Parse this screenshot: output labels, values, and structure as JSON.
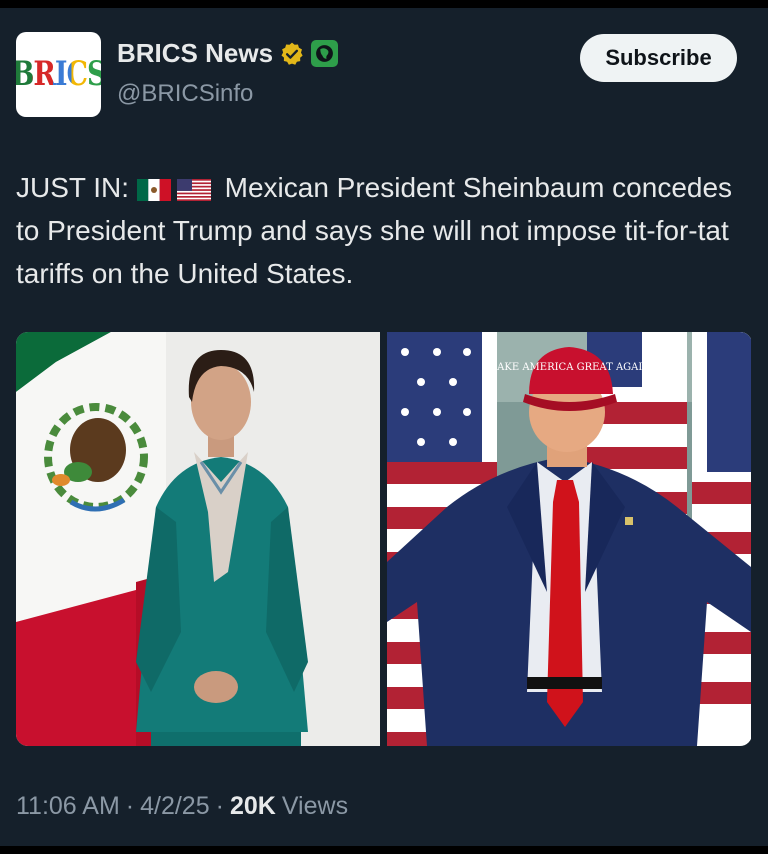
{
  "account": {
    "logo_text": "BRICS",
    "name": "BRICS News",
    "handle": "@BRICSinfo"
  },
  "actions": {
    "subscribe_label": "Subscribe"
  },
  "tweet": {
    "prefix": "JUST IN:",
    "flags": [
      "mexico-flag-icon",
      "us-flag-icon"
    ],
    "body": "Mexican President Sheinbaum concedes to President Trump and says she will not impose tit-for-tat tariffs on the United States.",
    "cap_text": "MAKE AMERICA GREAT AGAIN"
  },
  "meta": {
    "time": "11:06 AM",
    "date": "4/2/25",
    "views_count": "20K",
    "views_label": "Views",
    "separator": "·"
  },
  "colors": {
    "background": "#15202b",
    "text": "#e7e9ea",
    "secondary_text": "#8b98a5",
    "verified_gold": "#e2b719",
    "affiliate_green": "#2e9e4a"
  }
}
